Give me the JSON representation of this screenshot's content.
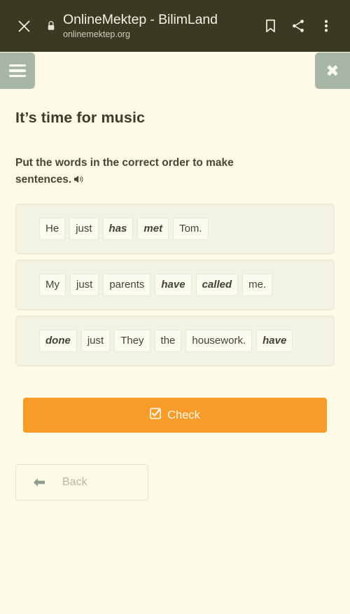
{
  "browser_bar": {
    "close_icon": "close-icon",
    "lock_icon": "lock-icon",
    "title": "OnlineMektep - BilimLand",
    "url": "onlinemektep.org",
    "actions": [
      {
        "icon": "bookmark-icon"
      },
      {
        "icon": "share-icon"
      },
      {
        "icon": "overflow-menu-icon"
      }
    ]
  },
  "toolbar": {
    "menu_icon": "hamburger-menu-icon",
    "close_label": "✖",
    "close_icon": "close-icon"
  },
  "lesson": {
    "title": "It’s time for music",
    "instruction": "Put the words in the correct order to make sentences.",
    "audio_icon": "speaker-icon"
  },
  "sentences": [
    {
      "words": [
        {
          "text": "He",
          "emphasis": false
        },
        {
          "text": "just",
          "emphasis": false
        },
        {
          "text": "has",
          "emphasis": true
        },
        {
          "text": "met",
          "emphasis": true
        },
        {
          "text": "Tom.",
          "emphasis": false
        }
      ]
    },
    {
      "words": [
        {
          "text": "My",
          "emphasis": false
        },
        {
          "text": "just",
          "emphasis": false
        },
        {
          "text": "parents",
          "emphasis": false
        },
        {
          "text": "have",
          "emphasis": true
        },
        {
          "text": "called",
          "emphasis": true
        },
        {
          "text": "me.",
          "emphasis": false
        }
      ]
    },
    {
      "words": [
        {
          "text": "done",
          "emphasis": true
        },
        {
          "text": "just",
          "emphasis": false
        },
        {
          "text": "They",
          "emphasis": false
        },
        {
          "text": "the",
          "emphasis": false
        },
        {
          "text": "housework.",
          "emphasis": false
        },
        {
          "text": "have",
          "emphasis": true
        }
      ]
    }
  ],
  "actions": {
    "check_label": "Check",
    "check_icon": "checked-box-icon",
    "back_label": "Back",
    "back_icon": "arrow-left-icon"
  },
  "colors": {
    "page_background": "#FDFBE8",
    "browser_bar": "#3A3A23",
    "toolbar_button": "#A8B6A8",
    "row_background": "#F3F3E3",
    "chip_background": "#FCFBEF",
    "check_button": "#F79C28",
    "text": "#45452F",
    "muted_text": "#B7B7A6"
  }
}
